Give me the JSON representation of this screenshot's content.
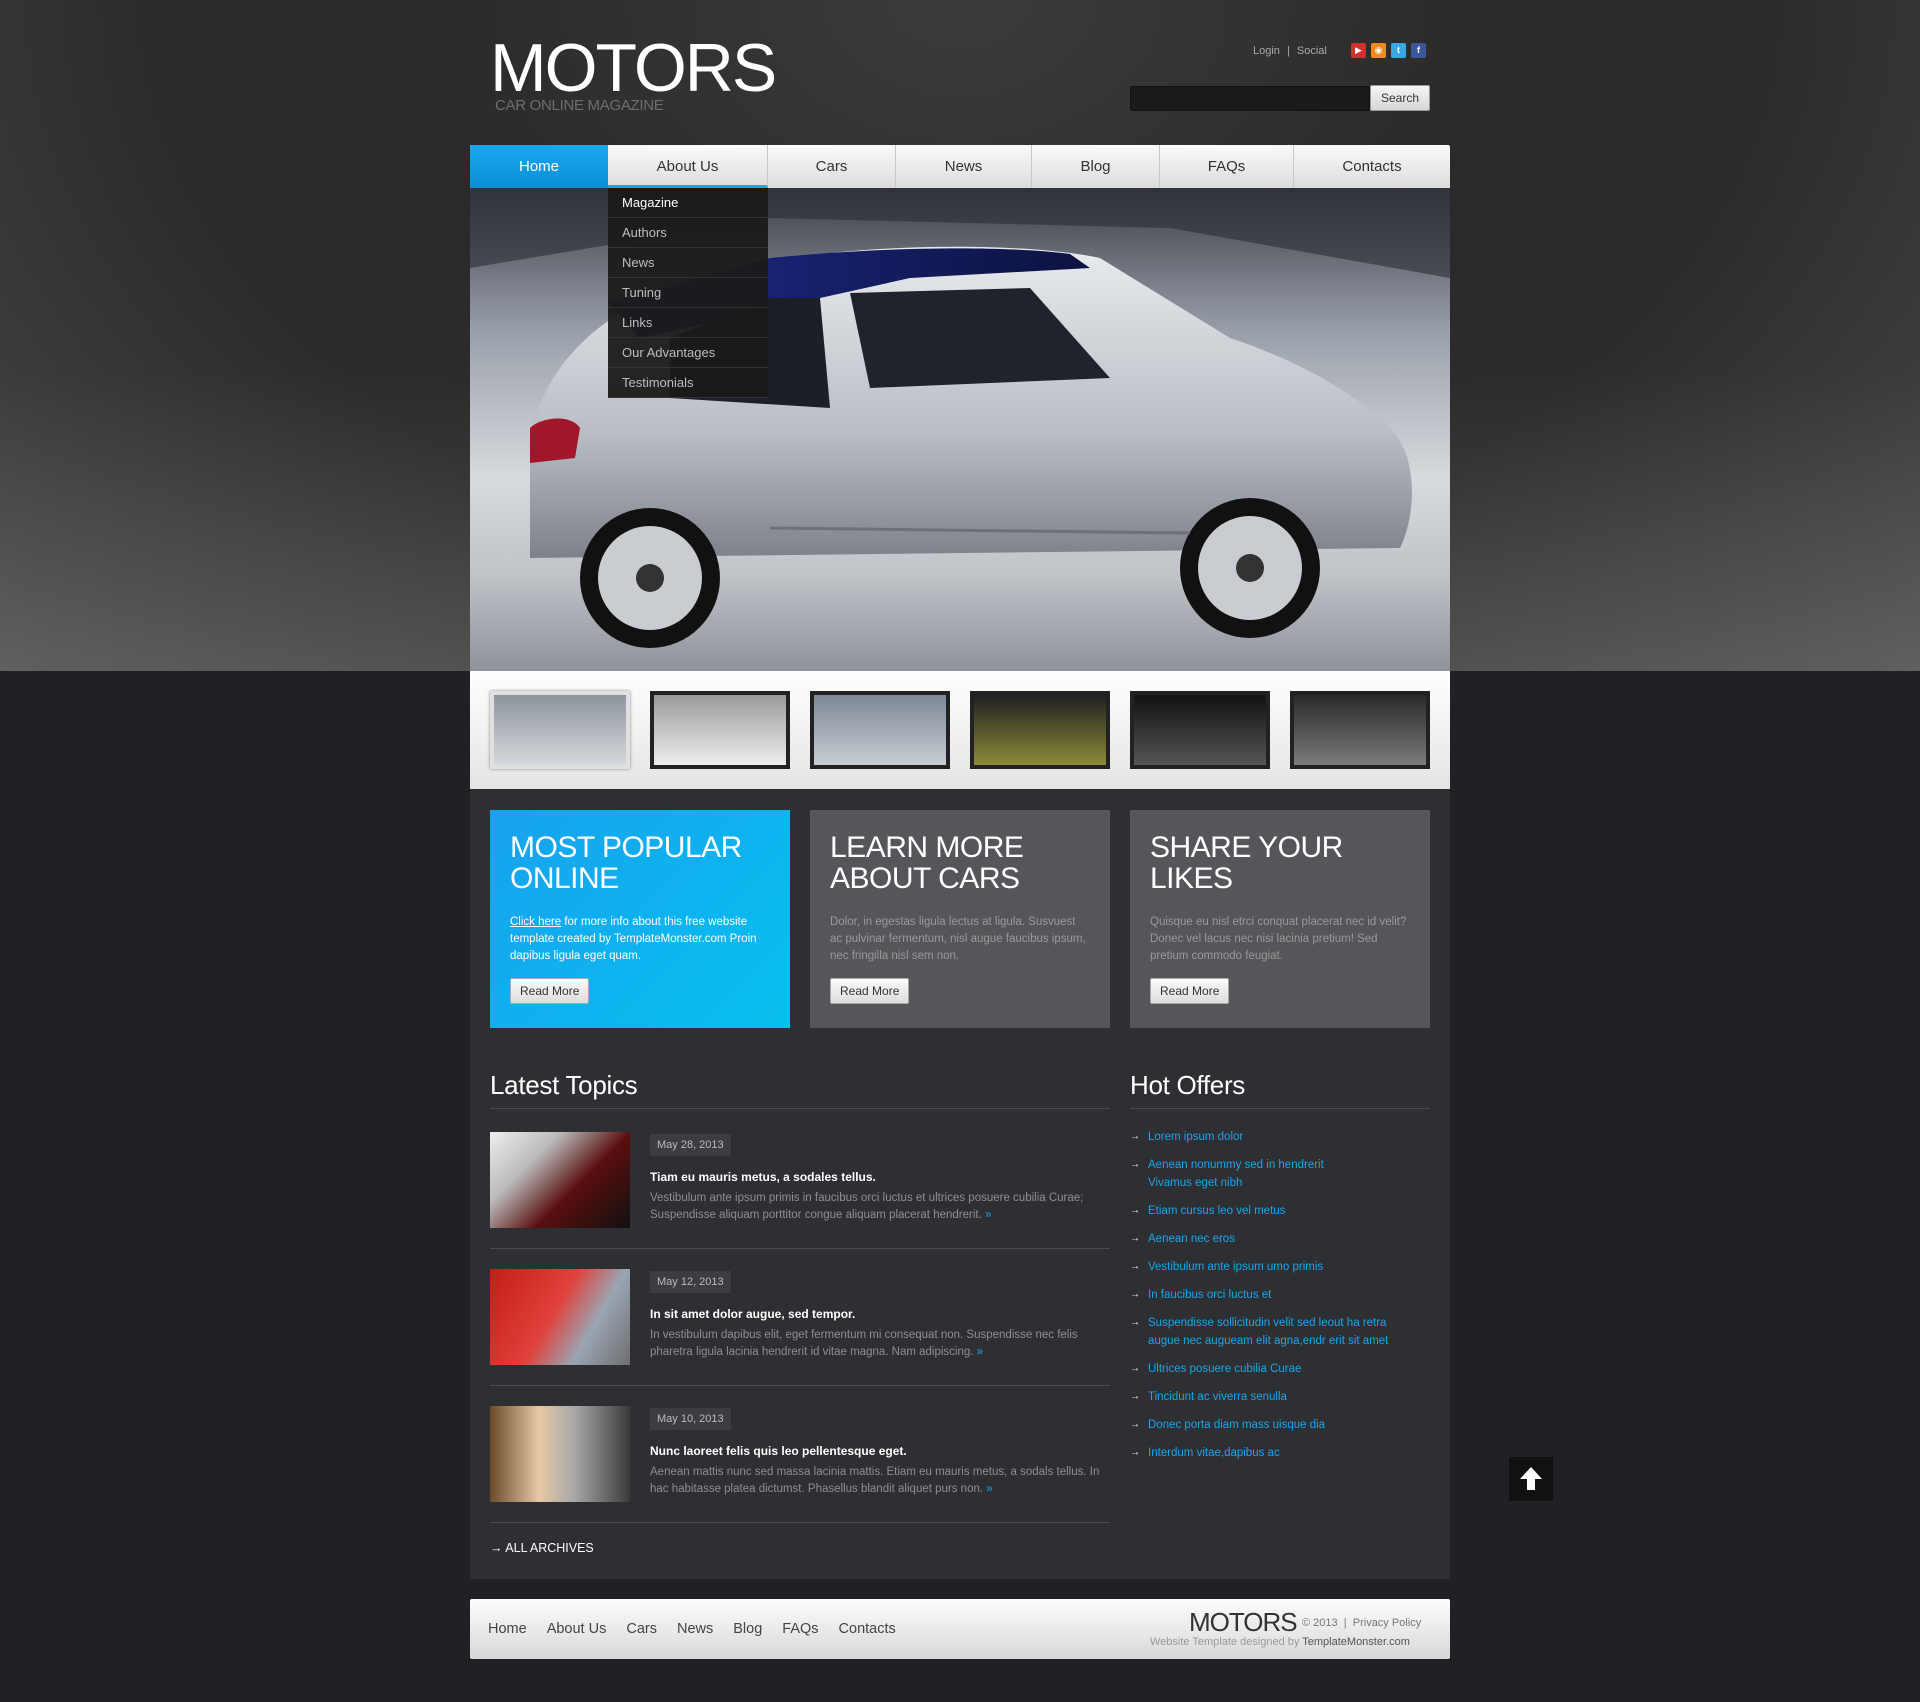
{
  "header": {
    "logo": "MOTORS",
    "tagline": "CAR ONLINE MAGAZINE",
    "login": "Login",
    "sep": "|",
    "social": "Social",
    "social_icons": [
      "youtube-icon",
      "rss-icon",
      "twitter-icon",
      "facebook-icon"
    ],
    "search_button": "Search",
    "search_placeholder": ""
  },
  "nav": {
    "items": [
      "Home",
      "About Us",
      "Cars",
      "News",
      "Blog",
      "FAQs",
      "Contacts"
    ],
    "active": "Home"
  },
  "dropdown": [
    "Magazine",
    "Authors",
    "News",
    "Tuning",
    "Links",
    "Our Advantages",
    "Testimonials"
  ],
  "boxes": [
    {
      "title_1": "MOST POPULAR",
      "title_2": "ONLINE",
      "link": "Click here",
      "text": " for more info about this free website template created by TemplateMonster.com Proin dapibus ligula eget quam.",
      "button": "Read More"
    },
    {
      "title_1": "LEARN MORE",
      "title_2": "ABOUT CARS",
      "text": "Dolor, in egestas ligula lectus at ligula. Susvuest ac pulvinar fermentum, nisl augue faucibus ipsum, nec fringilla nisl sem non.",
      "button": "Read More"
    },
    {
      "title_1": "SHARE YOUR",
      "title_2": "LIKES",
      "text": "Quisque eu nisl etrci conquat placerat nec id velit? Donec vel lacus nec nisi lacinia pretium! Sed pretium commodo feugiat.",
      "button": "Read More"
    }
  ],
  "latest": {
    "title": "Latest Topics",
    "topics": [
      {
        "date": "May 28, 2013",
        "heading": "Tiam eu mauris metus, a sodales tellus.",
        "text": "Vestibulum ante ipsum primis in faucibus orci luctus et ultrices posuere cubilia Curae; Suspendisse aliquam porttitor congue aliquam placerat hendrerit.",
        "more": "»"
      },
      {
        "date": "May 12, 2013",
        "heading": "In sit amet dolor augue, sed tempor.",
        "text": "In vestibulum dapibus elit, eget fermentum mi consequat non. Suspendisse nec felis pharetra ligula lacinia hendrerit id vitae magna. Nam adipiscing.",
        "more": "»"
      },
      {
        "date": "May 10, 2013",
        "heading": "Nunc laoreet felis quis leo pellentesque eget.",
        "text": "Aenean mattis nunc sed massa lacinia mattis. Etiam eu mauris metus, a sodals tellus. In hac habitasse platea dictumst. Phasellus blandit aliquet purs non.",
        "more": "»"
      }
    ],
    "archives": "ALL ARCHIVES"
  },
  "offers": {
    "title": "Hot Offers",
    "items": [
      "Lorem ipsum dolor",
      "Aenean nonummy sed in hendrerit Vivamus eget nibh",
      "Etiam cursus leo vel metus",
      "Aenean nec eros",
      "Vestibulum ante ipsum umo primis",
      "In faucibus orci luctus et",
      "Suspendisse sollicitudin velit sed leout ha retra augue nec augueam elit agna,endr erit sit amet",
      "Ultrices posuere cubilia Curae",
      "Tincidunt ac viverra senulla",
      "Donec porta diam mass uisque dia",
      "Interdum vitae,dapibus ac"
    ]
  },
  "footer": {
    "nav": [
      "Home",
      "About Us",
      "Cars",
      "News",
      "Blog",
      "FAQs",
      "Contacts"
    ],
    "logo": "MOTORS",
    "copy": "© 2013",
    "sep": "|",
    "privacy": "Privacy Policy",
    "designed": "Website Template designed by ",
    "designer": "TemplateMonster.com"
  },
  "colors": {
    "accent": "#1aa6ec",
    "panel": "#2e2f33",
    "box_grey": "#555659"
  }
}
